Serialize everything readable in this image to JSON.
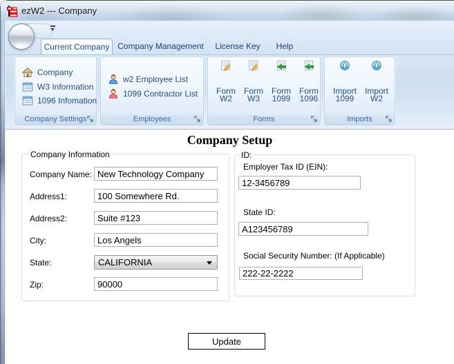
{
  "window": {
    "title": "ezW2 --- Company"
  },
  "ribbon": {
    "tabs": [
      {
        "label": "Current Company"
      },
      {
        "label": "Company Management"
      },
      {
        "label": "License Key"
      },
      {
        "label": "Help"
      }
    ],
    "groups": {
      "company_settings": {
        "title": "Company Settings",
        "items": [
          {
            "label": "Company",
            "icon": "house-icon"
          },
          {
            "label": "W3 Information",
            "icon": "form-list-icon"
          },
          {
            "label": "1096 Infomation",
            "icon": "form-list-icon"
          }
        ]
      },
      "employees": {
        "title": "Employees",
        "items": [
          {
            "label": "w2 Employee List",
            "icon": "person-blue-icon"
          },
          {
            "label": "1099 Contractor List",
            "icon": "person-red-icon"
          }
        ]
      },
      "forms": {
        "title": "Forms",
        "items": [
          {
            "line1": "Form",
            "line2": "W2",
            "icon": "form-edit-icon"
          },
          {
            "line1": "Form",
            "line2": "W3",
            "icon": "form-edit-icon"
          },
          {
            "line1": "Form",
            "line2": "1099",
            "icon": "form-export-icon"
          },
          {
            "line1": "Form",
            "line2": "1096",
            "icon": "form-export-icon"
          }
        ]
      },
      "imports": {
        "title": "Imports",
        "items": [
          {
            "line1": "Import",
            "line2": "1099",
            "icon": "import-icon"
          },
          {
            "line1": "Import",
            "line2": "W2",
            "icon": "import-icon"
          }
        ]
      }
    }
  },
  "page": {
    "heading": "Company Setup",
    "company_info": {
      "title": "Company Information",
      "name_label": "Company Name:",
      "name_value": "New Technology Company",
      "address1_label": "Address1:",
      "address1_value": "100 Somewhere Rd.",
      "address2_label": "Address2:",
      "address2_value": "Suite #123",
      "city_label": "City:",
      "city_value": "Los Angels",
      "state_label": "State:",
      "state_value": "CALIFORNIA",
      "zip_label": "Zip:",
      "zip_value": "90000"
    },
    "id_section": {
      "title": "ID:",
      "ein_label": "Employer Tax ID (EIN):",
      "ein_value": "12-3456789",
      "state_id_label": "State ID:",
      "state_id_value": "A123456789",
      "ssn_label": "Social Security Number: (If Applicable)",
      "ssn_value": "222-22-2222"
    },
    "update_label": "Update"
  }
}
